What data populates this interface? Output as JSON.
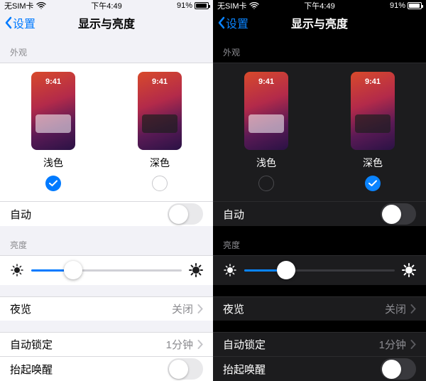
{
  "status": {
    "carrier": "无SIM卡",
    "time": "下午4:49",
    "battery_pct": "91%"
  },
  "nav": {
    "back_label": "设置",
    "title": "显示与亮度"
  },
  "sections": {
    "appearance_label": "外观",
    "brightness_label": "亮度"
  },
  "appearance": {
    "thumb_clock": "9:41",
    "light_label": "浅色",
    "dark_label": "深色",
    "left_pane_selected": "light",
    "right_pane_selected": "dark"
  },
  "rows": {
    "auto_label": "自动",
    "auto_on": false,
    "night_shift_label": "夜览",
    "night_shift_value": "关闭",
    "auto_lock_label": "自动锁定",
    "auto_lock_value": "1分钟",
    "raise_to_wake_label": "抬起唤醒",
    "raise_to_wake_on": false
  },
  "brightness_slider_pct": 28
}
